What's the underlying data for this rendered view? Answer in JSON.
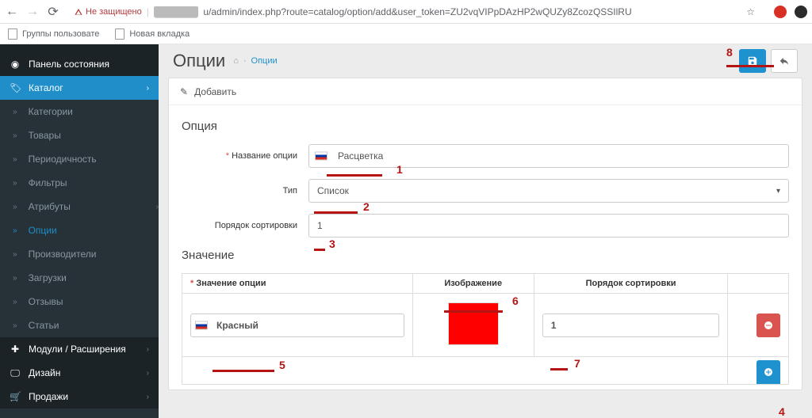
{
  "browser": {
    "back": "←",
    "forward": "→",
    "reload": "⟳",
    "not_secure": "Не защищено",
    "url_mask": "▓▓▓▓▓▓",
    "url": "u/admin/index.php?route=catalog/option/add&user_token=ZU2vqVIPpDAzHP2wQUZy8ZcozQSSIlRU",
    "star": "☆",
    "bookmarks": [
      {
        "label": "Группы пользовате"
      },
      {
        "label": "Новая вкладка"
      }
    ]
  },
  "sidebar": {
    "dashboard": "Панель состояния",
    "catalog": "Каталог",
    "sub": {
      "categories": "Категории",
      "products": "Товары",
      "recurring": "Периодичность",
      "filters": "Фильтры",
      "attributes": "Атрибуты",
      "options": "Опции",
      "manufacturers": "Производители",
      "downloads": "Загрузки",
      "reviews": "Отзывы",
      "articles": "Статьи"
    },
    "l1": {
      "extensions": "Модули / Расширения",
      "design": "Дизайн",
      "sale": "Продажи"
    }
  },
  "page": {
    "title": "Опции",
    "bc_home": "⌂",
    "bc_options": "Опции"
  },
  "panel": {
    "heading_icon": "✎",
    "heading": "Добавить"
  },
  "form": {
    "legend_option": "Опция",
    "legend_value": "Значение",
    "labels": {
      "name": "Название опции",
      "type": "Тип",
      "sort": "Порядок сортировки",
      "value_name": "Значение опции",
      "image": "Изображение",
      "sort_order": "Порядок сортировки"
    },
    "values": {
      "name": "Расцветка",
      "type": "Список",
      "sort": "1",
      "row_name": "Красный",
      "row_sort": "1"
    }
  },
  "annotations": {
    "n1": "1",
    "n2": "2",
    "n3": "3",
    "n4": "4",
    "n5": "5",
    "n6": "6",
    "n7": "7",
    "n8": "8"
  }
}
